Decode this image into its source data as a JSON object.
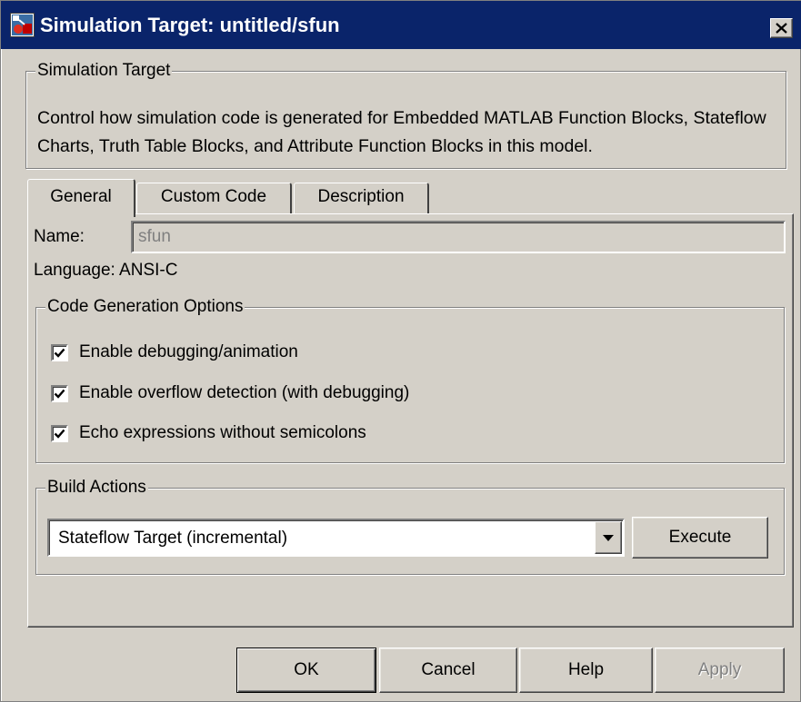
{
  "window": {
    "title": "Simulation Target: untitled/sfun",
    "close_glyph": "X"
  },
  "simulation_target": {
    "legend": "Simulation Target",
    "description": "Control how simulation code is generated for Embedded MATLAB Function Blocks, Stateflow Charts, Truth Table Blocks, and Attribute Function Blocks in this model."
  },
  "tabs": [
    {
      "label": "General",
      "active": true
    },
    {
      "label": "Custom Code",
      "active": false
    },
    {
      "label": "Description",
      "active": false
    }
  ],
  "general": {
    "name_label": "Name:",
    "name_value": "sfun",
    "language_text": "Language: ANSI-C",
    "code_gen": {
      "legend": "Code Generation Options",
      "options": [
        {
          "label": "Enable debugging/animation",
          "checked": true
        },
        {
          "label": "Enable overflow detection (with debugging)",
          "checked": true
        },
        {
          "label": "Echo expressions without semicolons",
          "checked": true
        }
      ]
    },
    "build": {
      "legend": "Build Actions",
      "selected": "Stateflow Target (incremental)",
      "execute_label": "Execute"
    }
  },
  "buttons": {
    "ok": "OK",
    "cancel": "Cancel",
    "help": "Help",
    "apply": "Apply"
  },
  "colors": {
    "titlebar": "#0a246a",
    "face": "#d4d0c8",
    "disabled_text": "#808080"
  },
  "icons": {
    "title": "stateflow-chart-icon",
    "close": "close-icon",
    "check": "checkmark-icon",
    "dropdown": "dropdown-arrow-icon"
  }
}
